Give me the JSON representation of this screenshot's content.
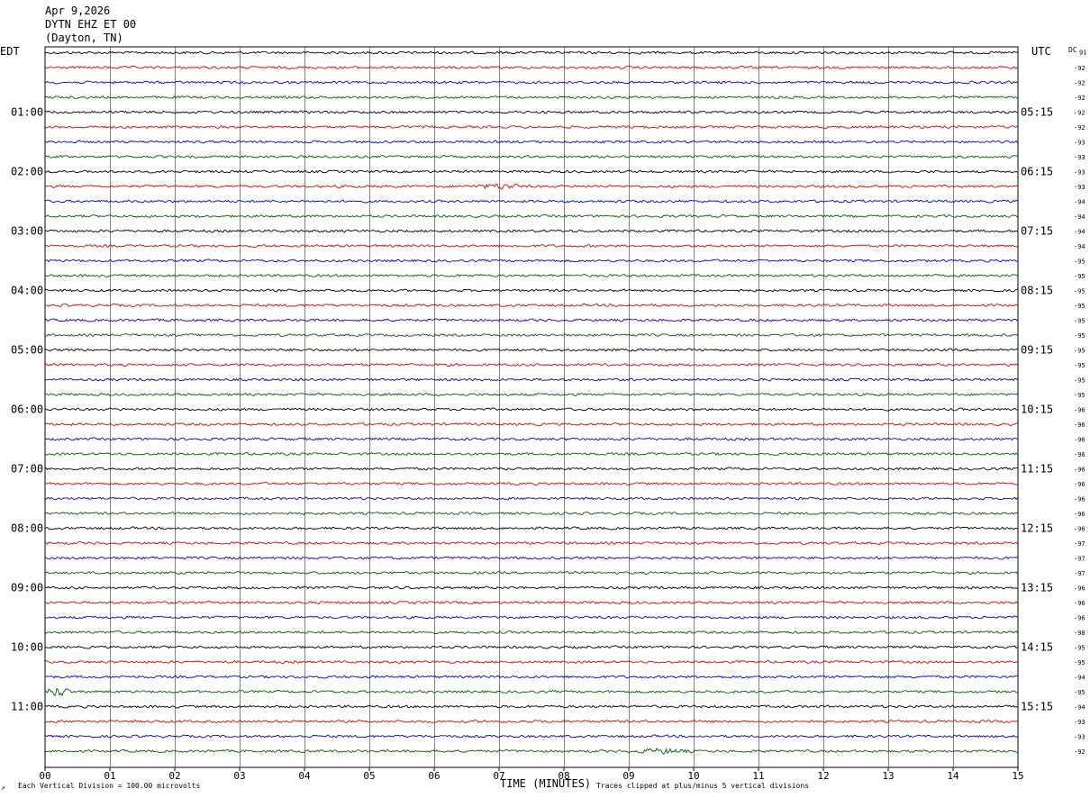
{
  "header": {
    "date": "Apr 9,2026",
    "station": "DYTN EHZ ET 00",
    "location": "(Dayton, TN)"
  },
  "labels": {
    "left_timezone": "EDT",
    "right_timezone": "UTC",
    "dc_label": "DC",
    "x_axis_title": "TIME (MINUTES)",
    "scale_note": "Each Vertical Division =  100.00 microvolts",
    "clip_note": "Traces clipped at plus/minus 5 vertical divisions",
    "corner_mark": "↗"
  },
  "colors": {
    "trace_cycle": [
      "#000000",
      "#e00000",
      "#0000d0",
      "#006000"
    ],
    "grid": "#000000",
    "background": "#ffffff"
  },
  "chart_data": {
    "type": "line",
    "title": "DYTN EHZ ET 00",
    "xlabel": "TIME (MINUTES)",
    "x_ticks": [
      "00",
      "01",
      "02",
      "03",
      "04",
      "05",
      "06",
      "07",
      "08",
      "09",
      "10",
      "11",
      "12",
      "13",
      "14",
      "15"
    ],
    "xlim": [
      0,
      15
    ],
    "rows_per_hour": 4,
    "row_count": 48,
    "left_hour_labels": [
      "01:00",
      "02:00",
      "03:00",
      "04:00",
      "05:00",
      "06:00",
      "07:00",
      "08:00",
      "09:00",
      "10:00",
      "11:00"
    ],
    "right_hour_labels": [
      "05:15",
      "06:15",
      "07:15",
      "08:15",
      "09:15",
      "10:15",
      "11:15",
      "12:15",
      "13:15",
      "14:15",
      "15:15"
    ],
    "dc_offsets": [
      "91",
      "-92",
      "-92",
      "-92",
      "-92",
      "-92",
      "-93",
      "-93",
      "-93",
      "-93",
      "-94",
      "-94",
      "-94",
      "-94",
      "-95",
      "-95",
      "-95",
      "-95",
      "-95",
      "-95",
      "-95",
      "-95",
      "-95",
      "-95",
      "-96",
      "-96",
      "-96",
      "-96",
      "-96",
      "-96",
      "-96",
      "-96",
      "-96",
      "-97",
      "-97",
      "-97",
      "-96",
      "-96",
      "-96",
      "-98",
      "-95",
      "-95",
      "-94",
      "-95",
      "-94",
      "-93",
      "-93",
      "-92"
    ],
    "events": [
      {
        "row": 43,
        "minute": 0.2,
        "amplitude": "large"
      },
      {
        "row": 47,
        "minute": 9.5,
        "amplitude": "moderate"
      },
      {
        "row": 9,
        "minute": 7.0,
        "amplitude": "moderate"
      }
    ]
  }
}
